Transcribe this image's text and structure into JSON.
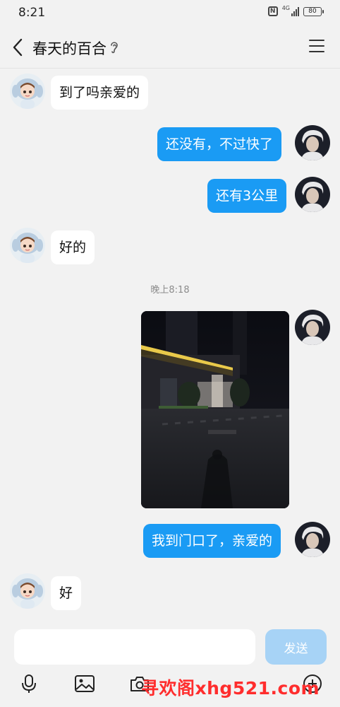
{
  "status_bar": {
    "time": "8:21",
    "network": "4G",
    "battery": "80"
  },
  "header": {
    "title": "春天的百合"
  },
  "messages": [
    {
      "sender": "contact",
      "text": "到了吗亲爱的"
    },
    {
      "sender": "me",
      "text": "还没有，不过快了"
    },
    {
      "sender": "me",
      "text": "还有3公里"
    },
    {
      "sender": "contact",
      "text": "好的"
    },
    {
      "type": "timestamp",
      "text": "晚上8:18"
    },
    {
      "sender": "me",
      "type": "image"
    },
    {
      "sender": "me",
      "text": "我到门口了，亲爱的"
    },
    {
      "sender": "contact",
      "text": "好"
    }
  ],
  "input": {
    "value": "",
    "placeholder": "",
    "send_label": "发送"
  },
  "toolbar": [
    "microphone-icon",
    "image-icon",
    "camera-icon",
    "add-icon"
  ],
  "watermark": "寻欢阁xhg521.com",
  "colors": {
    "outgoing_bubble": "#1a9bf4",
    "incoming_bubble": "#ffffff",
    "background": "#f2f2f2",
    "send_disabled": "#a7d3f6"
  }
}
